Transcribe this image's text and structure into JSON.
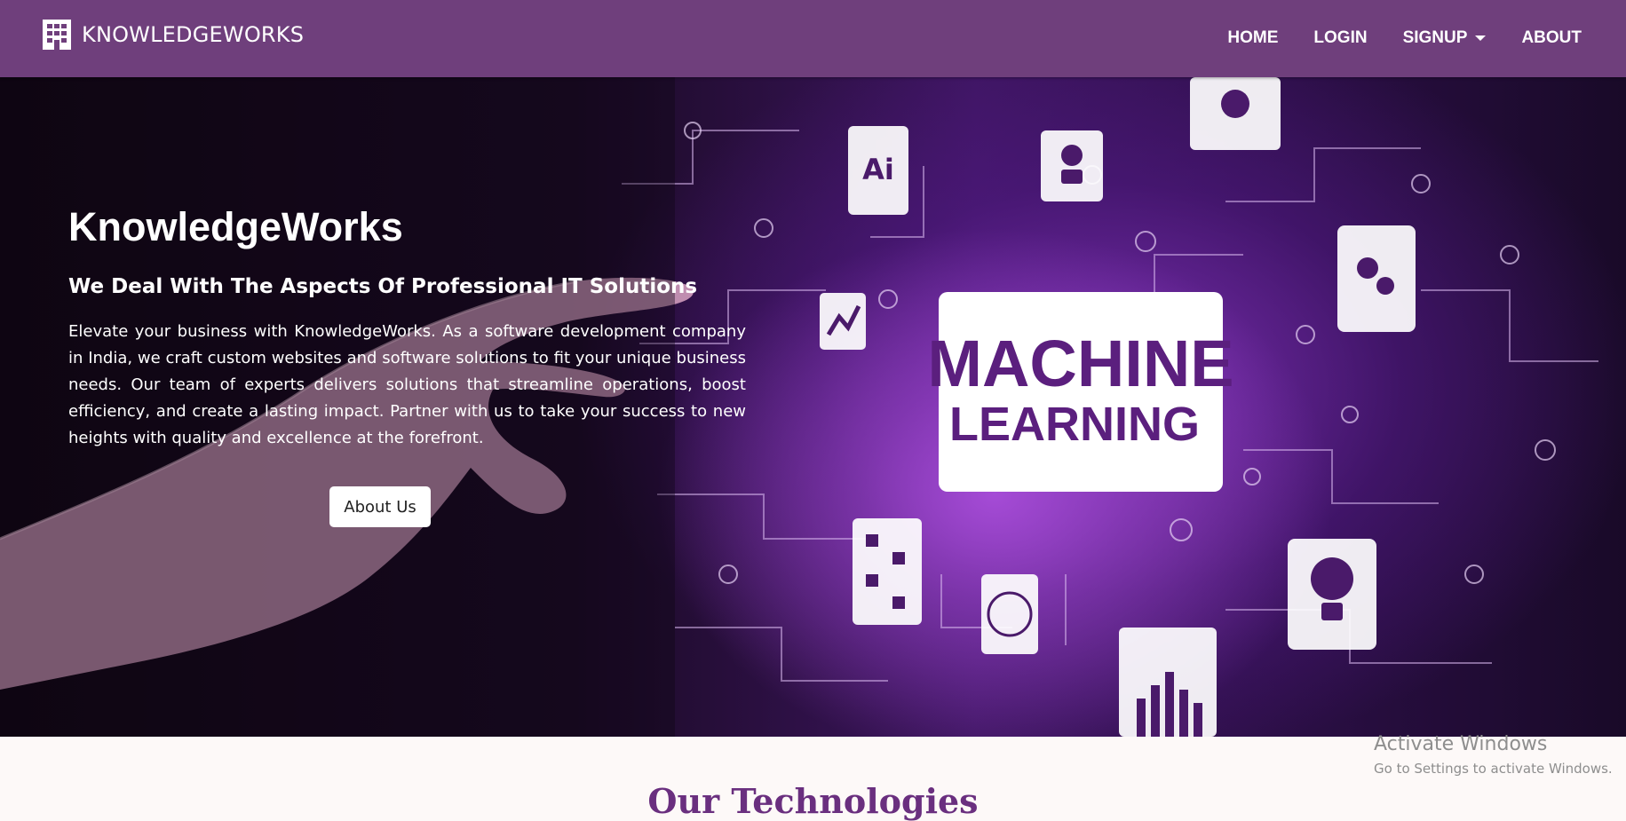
{
  "navbar": {
    "brand": "KNOWLEDGEWORKS",
    "brand_icon": "building-icon",
    "links": [
      {
        "label": "HOME"
      },
      {
        "label": "LOGIN"
      },
      {
        "label": "SIGNUP"
      },
      {
        "label": "ABOUT"
      }
    ]
  },
  "hero": {
    "title": "KnowledgeWorks",
    "subtitle": "We Deal With The Aspects Of Professional IT Solutions",
    "description": "Elevate your business with KnowledgeWorks. As a software development company in India, we craft custom websites and software solutions to fit your unique business needs. Our team of experts delivers solutions that streamline operations, boost efficiency, and create a lasting impact. Partner with us to take your success to new heights with quality and excellence at the forefront.",
    "button_label": "About Us",
    "image_text": {
      "line1": "MACHINE",
      "line2": "LEARNING"
    }
  },
  "technologies": {
    "title": "Our Technologies"
  },
  "watermark": {
    "title": "Activate Windows",
    "subtitle": "Go to Settings to activate Windows."
  },
  "colors": {
    "navbar_bg": "#6f3f7c",
    "accent_purple": "#6a2f7f",
    "page_bg": "#fdf9f8"
  }
}
